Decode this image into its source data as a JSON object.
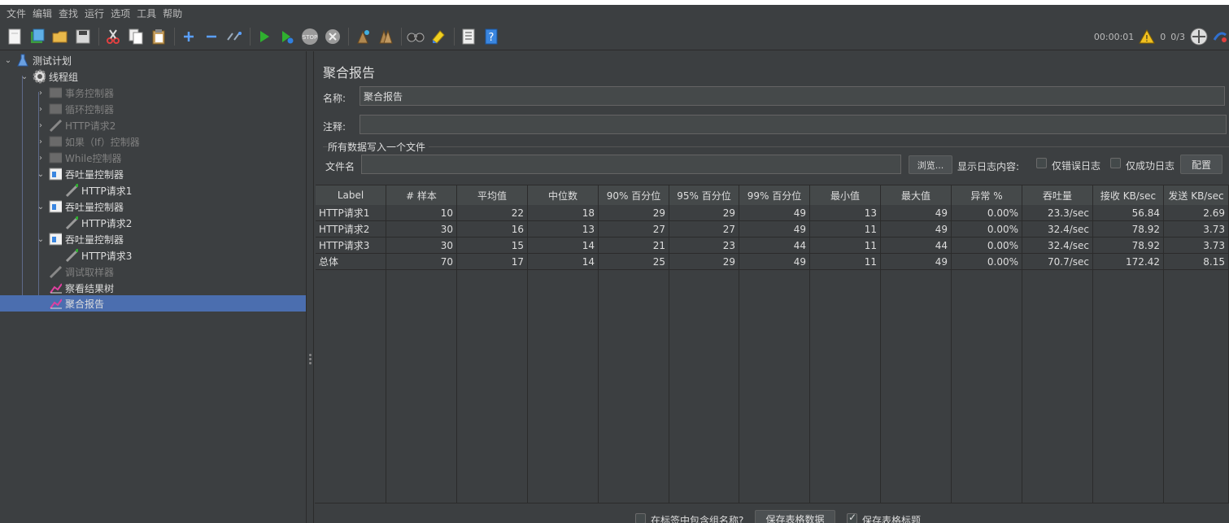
{
  "menu": [
    "文件",
    "编辑",
    "查找",
    "运行",
    "选项",
    "工具",
    "帮助"
  ],
  "toolbar": {
    "timer": "00:00:01",
    "warning_count": "0",
    "threads": "0/3"
  },
  "tree": [
    {
      "label": "测试计划",
      "icon": "flask-icon",
      "disabled": false
    },
    {
      "label": "线程组",
      "icon": "gear-icon",
      "disabled": false
    },
    {
      "label": "事务控制器",
      "icon": "controller-icon",
      "disabled": true
    },
    {
      "label": "循环控制器",
      "icon": "controller-icon",
      "disabled": true
    },
    {
      "label": "HTTP请求2",
      "icon": "pipette-icon",
      "disabled": true
    },
    {
      "label": "如果（If）控制器",
      "icon": "controller-icon",
      "disabled": true
    },
    {
      "label": "While控制器",
      "icon": "controller-icon",
      "disabled": true
    },
    {
      "label": "吞吐量控制器",
      "icon": "throughput-icon",
      "disabled": false
    },
    {
      "label": "HTTP请求1",
      "icon": "pipette-icon",
      "disabled": false
    },
    {
      "label": "吞吐量控制器",
      "icon": "throughput-icon",
      "disabled": false
    },
    {
      "label": "HTTP请求2",
      "icon": "pipette-icon",
      "disabled": false
    },
    {
      "label": "吞吐量控制器",
      "icon": "throughput-icon",
      "disabled": false
    },
    {
      "label": "HTTP请求3",
      "icon": "pipette-icon",
      "disabled": false
    },
    {
      "label": "调试取样器",
      "icon": "pipette-icon",
      "disabled": true
    },
    {
      "label": "察看结果树",
      "icon": "chart-icon",
      "disabled": false
    },
    {
      "label": "聚合报告",
      "icon": "chart-icon",
      "disabled": false
    }
  ],
  "panel": {
    "title": "聚合报告",
    "name_label": "名称:",
    "name_value": "聚合报告",
    "comment_label": "注释:",
    "comment_value": "",
    "group_title": "所有数据写入一个文件",
    "filename_label": "文件名",
    "filename_value": "",
    "browse_button": "浏览...",
    "log_label": "显示日志内容:",
    "errors_only": "仅错误日志",
    "success_only": "仅成功日志",
    "configure_button": "配置"
  },
  "table": {
    "headers": [
      "Label",
      "# 样本",
      "平均值",
      "中位数",
      "90% 百分位",
      "95% 百分位",
      "99% 百分位",
      "最小值",
      "最大值",
      "异常 %",
      "吞吐量",
      "接收 KB/sec",
      "发送 KB/sec"
    ],
    "rows": [
      [
        "HTTP请求1",
        "10",
        "22",
        "18",
        "29",
        "29",
        "49",
        "13",
        "49",
        "0.00%",
        "23.3/sec",
        "56.84",
        "2.69"
      ],
      [
        "HTTP请求2",
        "30",
        "16",
        "13",
        "27",
        "27",
        "49",
        "11",
        "49",
        "0.00%",
        "32.4/sec",
        "78.92",
        "3.73"
      ],
      [
        "HTTP请求3",
        "30",
        "15",
        "14",
        "21",
        "23",
        "44",
        "11",
        "44",
        "0.00%",
        "32.4/sec",
        "78.92",
        "3.73"
      ],
      [
        "总体",
        "70",
        "17",
        "14",
        "25",
        "29",
        "49",
        "11",
        "49",
        "0.00%",
        "70.7/sec",
        "172.42",
        "8.15"
      ]
    ]
  },
  "bottom": {
    "include_group": "在标签中包含组名称?",
    "save_table_button": "保存表格数据",
    "save_header": "保存表格标题"
  }
}
